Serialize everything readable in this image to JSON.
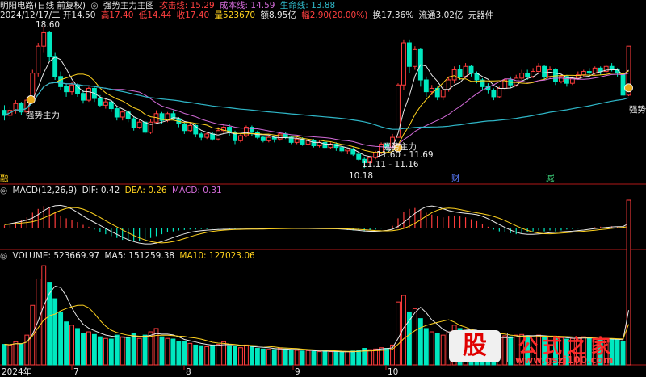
{
  "colors": {
    "background": "#000000",
    "up": "#ff3c3c",
    "down": "#00e8c0",
    "ma_white": "#e8e8e8",
    "ma_yellow": "#ffd21e",
    "ma_magenta": "#d36bd9",
    "ma_cyan": "#2fb7c8",
    "panel_border": "#b01818",
    "signal_icon": "#e6a71a"
  },
  "header": {
    "title": "明阳电路(日线 前复权)",
    "indicator_name": "强势主力主图",
    "attack_line": "攻击线: 15.29",
    "cost_line": "成本线: 14.59",
    "life_line": "生命线: 13.88"
  },
  "quote": {
    "date": "2024/12/17/二",
    "open": "开14.50",
    "high": "高17.40",
    "low": "低14.44",
    "close": "收17.40",
    "volume": "量523670",
    "amount": "额8.95亿",
    "change": "幅2.90(20.00%)",
    "turnover": "换17.36%",
    "float_cap": "流通3.02亿",
    "sector": "元器件"
  },
  "price_annotations": {
    "high_label": "18.60",
    "low_label": "10.18",
    "range_1": "11.60 - 11.69",
    "range_2": "11.11 - 11.16",
    "signal_label": "强势主力",
    "signal_label_right": "强势"
  },
  "markers": {
    "left": "融",
    "cai": "财",
    "jian": "减"
  },
  "macd_header": {
    "name": "MACD(12,26,9)",
    "dif": "DIF: 0.42",
    "dea": "DEA: 0.26",
    "macd": "MACD: 0.31"
  },
  "volume_header": {
    "name": "VOLUME: 523669.97",
    "ma5": "MA5: 151259.38",
    "ma10": "MA10: 127023.06"
  },
  "x_axis": [
    "2024年",
    "7",
    "8",
    "9",
    "10"
  ],
  "watermark": {
    "logo_char": "股",
    "title": "公式之家",
    "url": "www.gszj100.com"
  },
  "chart_data": {
    "type": "candlestick",
    "series_note": "daily OHLC, ~120 sessions ending 2024/12/17",
    "ylim": [
      10.18,
      18.6
    ],
    "candles": [
      [
        13.6,
        13.3,
        13.9,
        13.0
      ],
      [
        13.3,
        13.6,
        13.8,
        13.1
      ],
      [
        13.6,
        14.0,
        14.2,
        13.4
      ],
      [
        14.0,
        13.5,
        14.1,
        13.3
      ],
      [
        13.5,
        14.2,
        14.4,
        13.4
      ],
      [
        14.2,
        15.8,
        16.0,
        14.0
      ],
      [
        15.8,
        17.4,
        17.6,
        15.6
      ],
      [
        17.4,
        18.2,
        18.6,
        17.0
      ],
      [
        18.2,
        16.8,
        18.3,
        16.5
      ],
      [
        16.8,
        15.6,
        17.0,
        15.4
      ],
      [
        15.6,
        15.0,
        15.9,
        14.8
      ],
      [
        15.0,
        14.7,
        15.2,
        14.4
      ],
      [
        14.7,
        15.1,
        15.3,
        14.5
      ],
      [
        15.1,
        14.6,
        15.2,
        14.4
      ],
      [
        14.6,
        14.2,
        14.8,
        14.0
      ],
      [
        14.2,
        14.9,
        15.0,
        14.1
      ],
      [
        14.9,
        14.3,
        15.0,
        14.1
      ],
      [
        14.3,
        13.9,
        14.5,
        13.8
      ],
      [
        13.9,
        14.1,
        14.3,
        13.7
      ],
      [
        14.1,
        13.7,
        14.2,
        13.5
      ],
      [
        13.7,
        13.2,
        13.8,
        13.0
      ],
      [
        13.2,
        13.5,
        13.6,
        13.0
      ],
      [
        13.5,
        13.1,
        13.6,
        12.9
      ],
      [
        13.1,
        12.6,
        13.2,
        12.4
      ],
      [
        12.6,
        12.9,
        13.1,
        12.5
      ],
      [
        12.9,
        12.3,
        13.0,
        12.2
      ],
      [
        12.3,
        12.9,
        13.1,
        12.2
      ],
      [
        12.9,
        13.4,
        13.6,
        12.8
      ],
      [
        13.4,
        13.0,
        13.5,
        12.8
      ],
      [
        13.0,
        13.4,
        13.5,
        12.9
      ],
      [
        13.4,
        13.1,
        13.6,
        13.0
      ],
      [
        13.1,
        12.8,
        13.2,
        12.6
      ],
      [
        12.8,
        12.4,
        12.9,
        12.2
      ],
      [
        12.4,
        12.7,
        12.9,
        12.3
      ],
      [
        12.7,
        12.2,
        12.8,
        12.0
      ],
      [
        12.2,
        12.0,
        12.3,
        11.8
      ],
      [
        12.0,
        12.2,
        12.3,
        11.9
      ],
      [
        12.2,
        11.9,
        12.3,
        11.8
      ],
      [
        11.9,
        12.4,
        12.6,
        11.8
      ],
      [
        12.4,
        12.6,
        12.8,
        12.2
      ],
      [
        12.6,
        12.3,
        12.8,
        12.1
      ],
      [
        12.3,
        11.8,
        12.4,
        11.6
      ],
      [
        11.8,
        12.1,
        12.2,
        11.7
      ],
      [
        12.1,
        12.6,
        12.7,
        12.0
      ],
      [
        12.6,
        12.3,
        12.7,
        12.1
      ],
      [
        12.3,
        12.0,
        12.4,
        11.9
      ],
      [
        12.0,
        11.8,
        12.1,
        11.7
      ],
      [
        11.8,
        12.0,
        12.1,
        11.7
      ],
      [
        12.0,
        11.9,
        12.1,
        11.7
      ],
      [
        11.9,
        12.2,
        12.3,
        11.8
      ],
      [
        12.2,
        12.0,
        12.3,
        11.9
      ],
      [
        12.0,
        11.7,
        12.1,
        11.6
      ],
      [
        11.7,
        11.9,
        12.0,
        11.6
      ],
      [
        11.9,
        11.6,
        12.0,
        11.5
      ],
      [
        11.6,
        11.8,
        11.9,
        11.5
      ],
      [
        11.8,
        11.5,
        11.9,
        11.4
      ],
      [
        11.5,
        11.7,
        11.8,
        11.4
      ],
      [
        11.7,
        11.4,
        11.8,
        11.3
      ],
      [
        11.4,
        11.6,
        11.7,
        11.3
      ],
      [
        11.6,
        11.4,
        11.7,
        11.2
      ],
      [
        11.4,
        11.2,
        11.5,
        11.1
      ],
      [
        11.2,
        11.3,
        11.4,
        11.0
      ],
      [
        11.3,
        11.0,
        11.4,
        10.9
      ],
      [
        11.0,
        10.7,
        11.1,
        10.6
      ],
      [
        10.7,
        10.5,
        10.8,
        10.18
      ],
      [
        10.5,
        10.8,
        10.9,
        10.4
      ],
      [
        10.8,
        11.1,
        11.2,
        10.7
      ],
      [
        11.1,
        11.6,
        11.7,
        11.0
      ],
      [
        11.6,
        11.4,
        11.7,
        11.2
      ],
      [
        11.4,
        12.0,
        12.2,
        11.3
      ],
      [
        12.0,
        15.1,
        15.2,
        12.0
      ],
      [
        15.1,
        17.6,
        17.8,
        14.8
      ],
      [
        17.6,
        16.2,
        17.8,
        15.8
      ],
      [
        16.2,
        17.2,
        17.4,
        16.0
      ],
      [
        17.2,
        15.4,
        17.3,
        15.0
      ],
      [
        15.4,
        14.7,
        15.6,
        14.4
      ],
      [
        14.7,
        14.9,
        15.1,
        14.5
      ],
      [
        14.9,
        14.4,
        15.0,
        14.2
      ],
      [
        14.4,
        14.8,
        15.0,
        14.2
      ],
      [
        14.8,
        15.4,
        15.6,
        14.7
      ],
      [
        15.4,
        16.0,
        16.2,
        15.2
      ],
      [
        16.0,
        15.6,
        16.3,
        15.4
      ],
      [
        15.6,
        16.2,
        16.4,
        15.5
      ],
      [
        16.2,
        15.8,
        16.3,
        15.6
      ],
      [
        15.8,
        15.4,
        15.9,
        15.2
      ],
      [
        15.4,
        15.0,
        15.5,
        14.8
      ],
      [
        15.0,
        14.8,
        15.2,
        14.6
      ],
      [
        14.8,
        14.4,
        14.9,
        14.2
      ],
      [
        14.4,
        14.9,
        15.0,
        14.3
      ],
      [
        14.9,
        15.4,
        15.5,
        14.8
      ],
      [
        15.4,
        15.1,
        15.6,
        14.9
      ],
      [
        15.1,
        15.5,
        15.7,
        15.0
      ],
      [
        15.5,
        15.8,
        16.0,
        15.3
      ],
      [
        15.8,
        15.6,
        16.0,
        15.4
      ],
      [
        15.6,
        15.9,
        16.1,
        15.5
      ],
      [
        15.9,
        16.2,
        16.4,
        15.8
      ],
      [
        16.2,
        15.6,
        16.3,
        15.4
      ],
      [
        15.6,
        16.0,
        16.2,
        15.5
      ],
      [
        16.0,
        15.3,
        16.1,
        15.1
      ],
      [
        15.3,
        15.6,
        15.7,
        15.2
      ],
      [
        15.6,
        15.2,
        15.7,
        15.0
      ],
      [
        15.2,
        15.5,
        15.6,
        15.1
      ],
      [
        15.5,
        15.7,
        15.9,
        15.4
      ],
      [
        15.7,
        15.9,
        16.0,
        15.6
      ],
      [
        15.9,
        15.8,
        16.1,
        15.6
      ],
      [
        15.8,
        16.1,
        16.2,
        15.7
      ],
      [
        16.1,
        15.9,
        16.2,
        15.7
      ],
      [
        15.9,
        16.2,
        16.3,
        15.8
      ],
      [
        16.2,
        16.0,
        16.4,
        15.9
      ],
      [
        16.0,
        15.8,
        16.1,
        15.6
      ],
      [
        15.8,
        14.5,
        15.9,
        14.4
      ],
      [
        14.5,
        17.4,
        17.4,
        14.44
      ]
    ],
    "macd_hist": [
      0.05,
      0.08,
      0.12,
      0.16,
      0.22,
      0.32,
      0.4,
      0.46,
      0.42,
      0.34,
      0.26,
      0.2,
      0.16,
      0.12,
      0.06,
      0.02,
      -0.04,
      -0.1,
      -0.14,
      -0.18,
      -0.22,
      -0.26,
      -0.28,
      -0.3,
      -0.28,
      -0.26,
      -0.22,
      -0.18,
      -0.14,
      -0.1,
      -0.08,
      -0.06,
      -0.05,
      -0.04,
      -0.04,
      -0.03,
      -0.03,
      -0.02,
      -0.02,
      -0.02,
      -0.03,
      -0.03,
      -0.02,
      -0.01,
      -0.02,
      -0.02,
      -0.01,
      -0.01,
      -0.01,
      0.0,
      -0.01,
      -0.02,
      -0.02,
      -0.02,
      -0.01,
      -0.01,
      -0.02,
      -0.02,
      -0.02,
      -0.03,
      -0.04,
      -0.05,
      -0.06,
      -0.07,
      -0.08,
      -0.06,
      -0.04,
      -0.02,
      0.0,
      0.04,
      0.2,
      0.34,
      0.4,
      0.42,
      0.38,
      0.32,
      0.28,
      0.24,
      0.22,
      0.24,
      0.26,
      0.24,
      0.22,
      0.18,
      0.14,
      0.08,
      0.02,
      -0.04,
      -0.08,
      -0.1,
      -0.12,
      -0.14,
      -0.12,
      -0.1,
      -0.08,
      -0.06,
      -0.08,
      -0.06,
      -0.08,
      -0.06,
      -0.04,
      -0.03,
      -0.02,
      -0.01,
      0.0,
      0.01,
      0.02,
      0.02,
      0.03,
      0.02,
      0.01,
      0.31
    ],
    "volume": [
      62000,
      60000,
      70000,
      64000,
      90000,
      180000,
      260000,
      300000,
      250000,
      200000,
      160000,
      130000,
      120000,
      110000,
      95000,
      100000,
      92000,
      85000,
      80000,
      78000,
      90000,
      85000,
      82000,
      95000,
      80000,
      90000,
      100000,
      110000,
      85000,
      80000,
      78000,
      70000,
      72000,
      65000,
      60000,
      58000,
      55000,
      60000,
      62000,
      70000,
      58000,
      55000,
      52000,
      60000,
      55000,
      50000,
      48000,
      47000,
      46000,
      50000,
      48000,
      45000,
      44000,
      42000,
      43000,
      41000,
      40000,
      42000,
      40000,
      39000,
      38000,
      40000,
      42000,
      45000,
      50000,
      46000,
      48000,
      52000,
      50000,
      60000,
      190000,
      210000,
      160000,
      170000,
      140000,
      110000,
      100000,
      95000,
      90000,
      100000,
      120000,
      110000,
      105000,
      98000,
      90000,
      85000,
      80000,
      78000,
      82000,
      88000,
      85000,
      90000,
      92000,
      88000,
      85000,
      90000,
      86000,
      84000,
      80000,
      82000,
      78000,
      80000,
      82000,
      85000,
      80000,
      78000,
      75000,
      80000,
      78000,
      76000,
      70000,
      523670
    ]
  }
}
